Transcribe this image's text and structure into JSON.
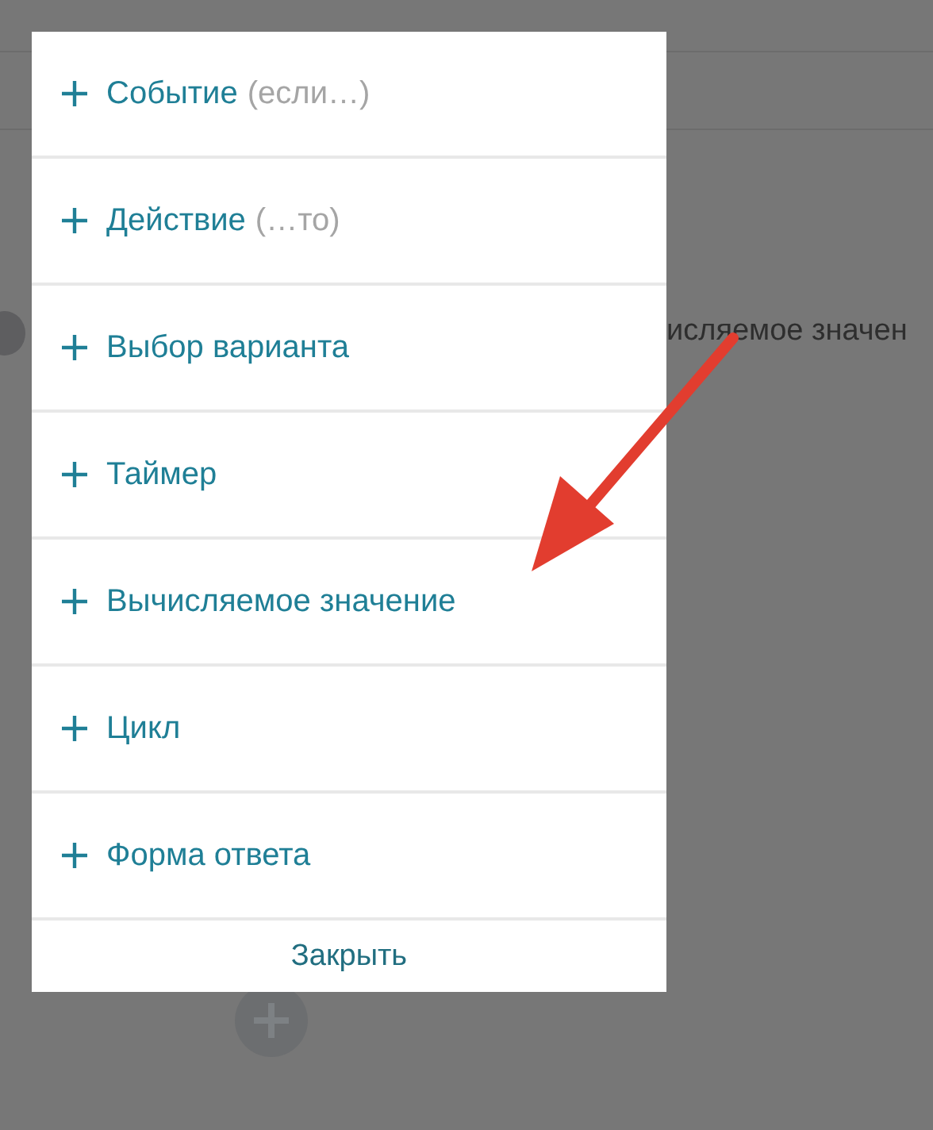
{
  "background": {
    "text": "исляемое значен"
  },
  "menu": {
    "items": [
      {
        "label": "Событие",
        "hint": "(если…)"
      },
      {
        "label": "Действие",
        "hint": "(…то)"
      },
      {
        "label": "Выбор варианта"
      },
      {
        "label": "Таймер"
      },
      {
        "label": "Вычисляемое значение"
      },
      {
        "label": "Цикл"
      },
      {
        "label": "Форма ответа"
      }
    ],
    "close": "Закрыть"
  }
}
